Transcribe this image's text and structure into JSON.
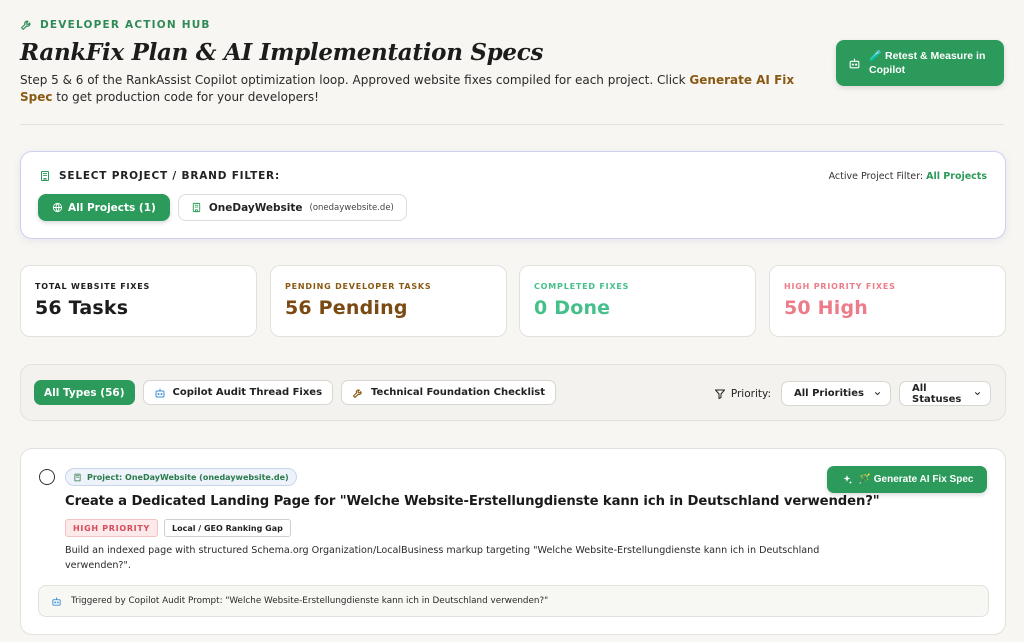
{
  "header": {
    "eyebrow": "DEVELOPER ACTION HUB",
    "title": "RankFix Plan & AI Implementation Specs",
    "subtitle_pre": "Step 5 & 6 of the RankAssist Copilot optimization loop. Approved website fixes compiled for each project. Click ",
    "subtitle_highlight": "Generate AI Fix Spec",
    "subtitle_post": " to get production code for your developers!",
    "retest_button_emoji": "🧪",
    "retest_button_label": "Retest & Measure in Copilot"
  },
  "project_filter": {
    "label": "SELECT PROJECT / BRAND FILTER:",
    "active_label": "Active Project Filter:",
    "active_value": "All Projects",
    "all_projects_label": "All Projects (1)",
    "project_name": "OneDayWebsite",
    "project_domain": "(onedaywebsite.de)"
  },
  "stats": [
    {
      "label": "TOTAL WEBSITE FIXES",
      "value": "56 Tasks",
      "color": "#1c1c1c",
      "label_color": "#1c1c1c"
    },
    {
      "label": "PENDING DEVELOPER TASKS",
      "value": "56 Pending",
      "color": "#7a4a12",
      "label_color": "#8a5a14"
    },
    {
      "label": "COMPLETED FIXES",
      "value": "0 Done",
      "color": "#45c08a",
      "label_color": "#45c08a"
    },
    {
      "label": "HIGH PRIORITY FIXES",
      "value": "50 High",
      "color": "#ec7c8a",
      "label_color": "#ec7c8a"
    }
  ],
  "filters": {
    "types": [
      "All Types (56)",
      "Copilot Audit Thread Fixes",
      "Technical Foundation Checklist"
    ],
    "priority_label": "Priority:",
    "priority_value": "All Priorities",
    "status_value": "All Statuses"
  },
  "task": {
    "project_tag": "Project: OneDayWebsite (onedaywebsite.de)",
    "title": "Create a Dedicated Landing Page for \"Welche Website-Erstellungdienste kann ich in Deutschland verwenden?\"",
    "priority_badge": "HIGH PRIORITY",
    "category_badge": "Local / GEO Ranking Gap",
    "description": "Build an indexed page with structured Schema.org Organization/LocalBusiness markup targeting \"Welche Website-Erstellungdienste kann ich in Deutschland verwenden?\".",
    "generate_button_emoji": "🪄",
    "generate_button_label": "Generate AI Fix Spec",
    "trigger_text": "Triggered by Copilot Audit Prompt: \"Welche Website-Erstellungdienste kann ich in Deutschland verwenden?\""
  },
  "colors": {
    "brand_green": "#2b9a5a",
    "highlight_brown": "#8a5a14",
    "high_priority_red": "#d44d5c"
  },
  "icons": {
    "eyebrow": "wrench-icon",
    "retest": "robot-icon",
    "filter_label": "building-icon",
    "all_projects": "globe-icon",
    "project": "building-icon",
    "copilot_type": "robot-icon",
    "technical_type": "wrench-icon",
    "priority": "funnel-icon",
    "select": "chevron-down-icon",
    "generate": "sparkles-icon",
    "trigger": "robot-icon"
  }
}
